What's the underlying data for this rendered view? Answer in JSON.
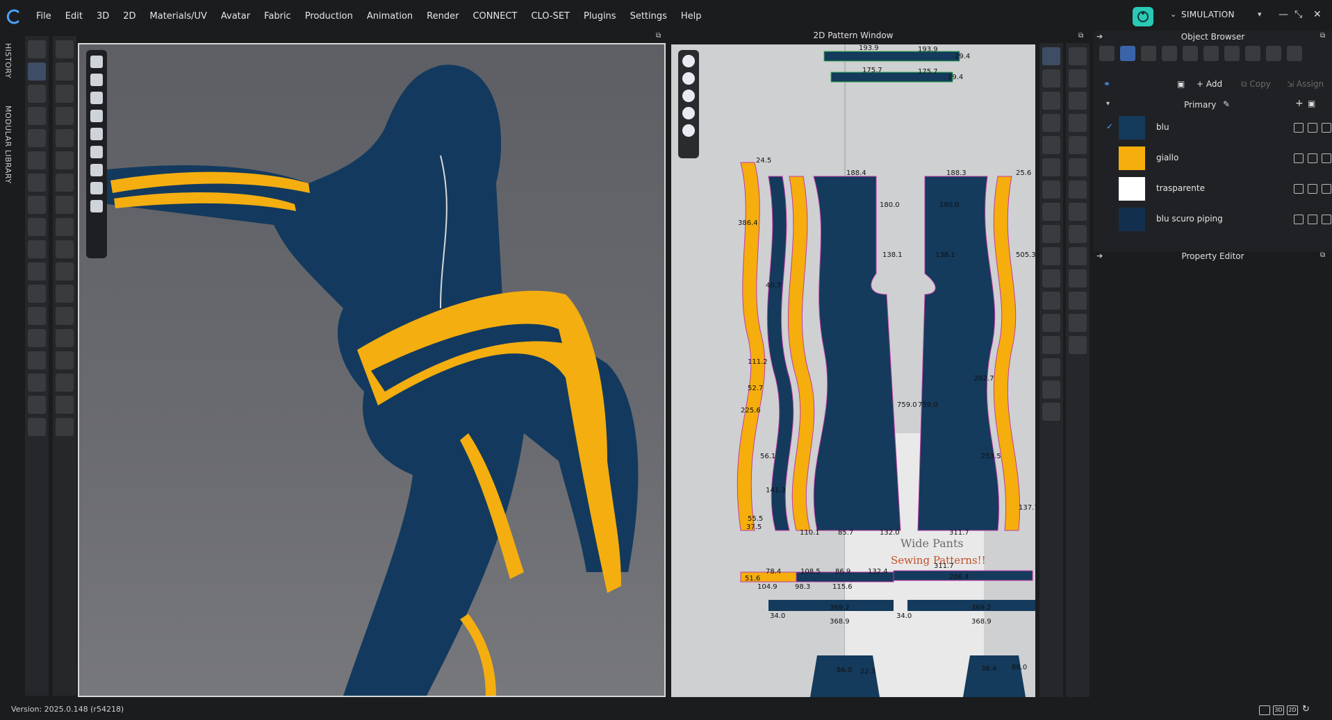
{
  "menubar": {
    "items": [
      "File",
      "Edit",
      "3D",
      "2D",
      "Materials/UV",
      "Avatar",
      "Fabric",
      "Production",
      "Animation",
      "Render",
      "CONNECT",
      "CLO-SET",
      "Plugins",
      "Settings",
      "Help"
    ],
    "mode_label": "SIMULATION"
  },
  "sidetabs": {
    "history": "HISTORY",
    "library": "MODULAR LIBRARY"
  },
  "pattern_window": {
    "title": "2D Pattern Window",
    "annotation_line1": "Wide Pants",
    "annotation_line2": "Sewing Patterns!!",
    "labels": {
      "top1": "193.9",
      "top2": "193.9",
      "top3": "175.7",
      "top4": "175.7",
      "top5": "29.4",
      "top6": "29.4",
      "l1": "24.5",
      "l2": "386.4",
      "l3": "40.7",
      "l4": "111.2",
      "l5": "52.7",
      "l6": "225.6",
      "l7": "56.1",
      "l8": "141.3",
      "l9": "55.5",
      "l10": "37.5",
      "w1": "188.4",
      "w2": "188.3",
      "w3": "180.0",
      "w4": "180.0",
      "w5": "138.1",
      "w6": "138.1",
      "w7": "759.0",
      "w8": "759.0",
      "w9": "110.1",
      "w10": "85.7",
      "w11": "132.0",
      "w12": "311.7",
      "s1": "25.6",
      "s2": "505.3",
      "s3": "262.7",
      "s4": "253.5",
      "s5": "137.7",
      "b1": "78.4",
      "b2": "108.5",
      "b3": "86.9",
      "b4": "132.4",
      "b5": "311.7",
      "b6": "104.9",
      "b7": "98.3",
      "b8": "115.6",
      "b9": "206.4",
      "b10": "51.6",
      "c1": "369.2",
      "c2": "369.2",
      "c3": "368.9",
      "c4": "368.9",
      "c5": "34.0",
      "c6": "34.0",
      "d1": "86.0",
      "d2": "22.3",
      "d3": "36.4",
      "d4": "86.0"
    }
  },
  "object_browser": {
    "title": "Object Browser",
    "add_label": "Add",
    "copy_label": "Copy",
    "assign_label": "Assign",
    "colorway": "Primary",
    "materials": [
      {
        "name": "blu",
        "color": "#143a5c",
        "checked": true
      },
      {
        "name": "giallo",
        "color": "#f5ae0c",
        "checked": false
      },
      {
        "name": "trasparente",
        "color": "#ffffff",
        "checked": false
      },
      {
        "name": "blu scuro piping",
        "color": "#12304e",
        "checked": false
      }
    ],
    "check_mark": "✓"
  },
  "property_editor": {
    "title": "Property Editor"
  },
  "status": {
    "version": "Version: 2025.0.148 (r54218)",
    "view_3d": "3D",
    "view_2d": "2D"
  },
  "colors": {
    "navy": "#143a5c",
    "yellow": "#f5ae0c",
    "accent": "#29c9b5"
  }
}
